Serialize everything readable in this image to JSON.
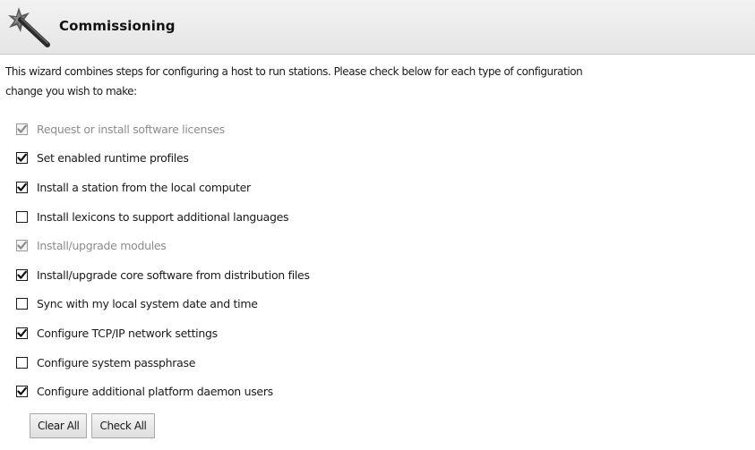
{
  "header": {
    "title": "Commissioning",
    "icon": "magic-wand-icon"
  },
  "intro": {
    "line1": "This wizard combines steps for configuring a host to run stations. Please check below for each type of configuration",
    "line2": "change you wish to make:"
  },
  "options": [
    {
      "label": "Request or install software licenses",
      "checked": true,
      "disabled": true
    },
    {
      "label": "Set enabled runtime profiles",
      "checked": true,
      "disabled": false
    },
    {
      "label": "Install a station from the local computer",
      "checked": true,
      "disabled": false
    },
    {
      "label": "Install lexicons to support additional languages",
      "checked": false,
      "disabled": false
    },
    {
      "label": "Install/upgrade modules",
      "checked": true,
      "disabled": true
    },
    {
      "label": "Install/upgrade core software from distribution files",
      "checked": true,
      "disabled": false
    },
    {
      "label": "Sync with my local system date and time",
      "checked": false,
      "disabled": false
    },
    {
      "label": "Configure TCP/IP network settings",
      "checked": true,
      "disabled": false
    },
    {
      "label": "Configure system passphrase",
      "checked": false,
      "disabled": false
    },
    {
      "label": "Configure additional platform daemon users",
      "checked": true,
      "disabled": false
    }
  ],
  "buttons": {
    "clear_all": "Clear All",
    "check_all": "Check All"
  }
}
